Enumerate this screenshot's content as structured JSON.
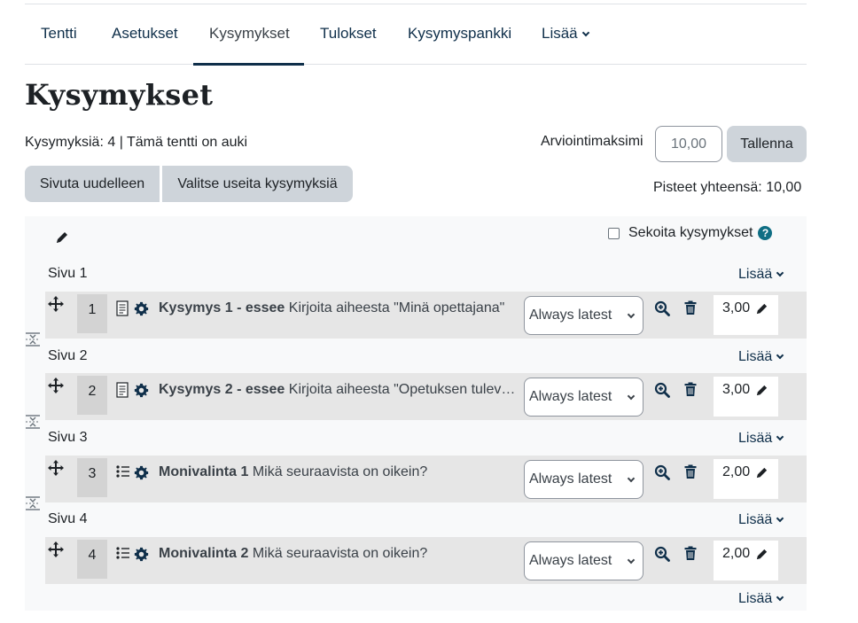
{
  "tabs": [
    {
      "label": "Tentti"
    },
    {
      "label": "Asetukset"
    },
    {
      "label": "Kysymykset"
    },
    {
      "label": "Tulokset"
    },
    {
      "label": "Kysymyspankki"
    },
    {
      "label": "Lisää"
    }
  ],
  "page_title": "Kysymykset",
  "summary": "Kysymyksiä: 4 | Tämä tentti on auki",
  "max_grade": {
    "label": "Arviointimaksimi",
    "value": "10,00",
    "save_label": "Tallenna"
  },
  "buttons": {
    "repaginate": "Sivuta uudelleen",
    "select_multiple": "Valitse useita kysymyksiä"
  },
  "total": "Pisteet yhteensä: 10,00",
  "shuffle_label": "Sekoita kysymykset",
  "add_label": "Lisää",
  "pages": [
    {
      "label": "Sivu 1"
    },
    {
      "label": "Sivu 2"
    },
    {
      "label": "Sivu 3"
    },
    {
      "label": "Sivu 4"
    }
  ],
  "questions": [
    {
      "num": "1",
      "type_icon": "essay-icon",
      "name": "Kysymys 1 - essee",
      "text": "Kirjoita aiheesta \"Minä opettajana\"",
      "version": "Always latest",
      "mark": "3,00"
    },
    {
      "num": "2",
      "type_icon": "essay-icon",
      "name": "Kysymys 2 - essee",
      "text": "Kirjoita aiheesta \"Opetuksen tulevaisuus\"",
      "version": "Always latest",
      "mark": "3,00"
    },
    {
      "num": "3",
      "type_icon": "multichoice-icon",
      "name": "Monivalinta 1",
      "text": "Mikä seuraavista on oikein?",
      "version": "Always latest",
      "mark": "2,00"
    },
    {
      "num": "4",
      "type_icon": "multichoice-icon",
      "name": "Monivalinta 2",
      "text": "Mikä seuraavista on oikein?",
      "version": "Always latest",
      "mark": "2,00"
    }
  ],
  "colors": {
    "link": "#0f2f4a",
    "button": "#ced4da",
    "panel": "#f8f9fa",
    "row": "#e6e6e6",
    "help": "#0f6e84"
  }
}
